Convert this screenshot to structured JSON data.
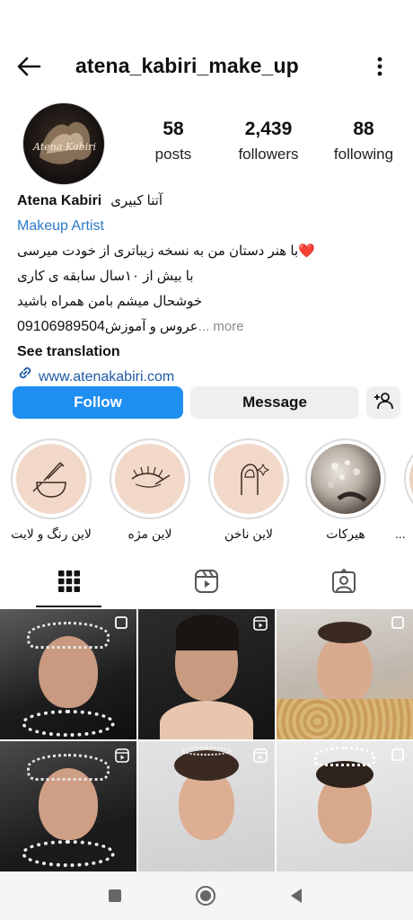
{
  "header": {
    "username": "atena_kabiri_make_up"
  },
  "profile": {
    "avatar_text": "Atena Kabiri",
    "stats": [
      {
        "value": "58",
        "label": "posts"
      },
      {
        "value": "2,439",
        "label": "followers"
      },
      {
        "value": "88",
        "label": "following"
      }
    ]
  },
  "bio": {
    "name": "Atena Kabiri",
    "name_fa": "آتنا کبیری",
    "category": "Makeup Artist",
    "line1": "با هنر دستان من به نسخه زیباتری از خودت میرسی",
    "line1_emoji": "❤️",
    "line2": "با بیش از ۱۰سال سابقه ی کاری",
    "line3": "خوشحال میشم بامن همراه باشید",
    "line4_phone": "09106989504",
    "line4_text": "عروس و آموزش",
    "more": "... more",
    "see_translation": "See translation",
    "website": "www.atenakabiri.com"
  },
  "actions": {
    "follow": "Follow",
    "message": "Message"
  },
  "highlights": [
    {
      "label": "لاین رنگ و لایت",
      "icon": "hair-color-bowl-icon"
    },
    {
      "label": "لاین مژه",
      "icon": "eyelash-icon"
    },
    {
      "label": "لاین ناخن",
      "icon": "nail-icon"
    },
    {
      "label": "هیرکات",
      "icon": "haircut-photo"
    },
    {
      "label": "...",
      "icon": "partial-highlight"
    }
  ],
  "tabs": [
    {
      "name": "grid",
      "icon": "grid-icon",
      "active": true
    },
    {
      "name": "reels",
      "icon": "reels-icon",
      "active": false
    },
    {
      "name": "tagged",
      "icon": "tagged-icon",
      "active": false
    }
  ],
  "posts": [
    {
      "badge": "carousel-icon"
    },
    {
      "badge": "reels-icon"
    },
    {
      "badge": "carousel-icon"
    },
    {
      "badge": "reels-icon"
    },
    {
      "badge": "reels-icon"
    },
    {
      "badge": "carousel-icon"
    }
  ],
  "colors": {
    "follow_button": "#1f8ef1",
    "link": "#1f5aa6",
    "category": "#2a7ac8"
  }
}
